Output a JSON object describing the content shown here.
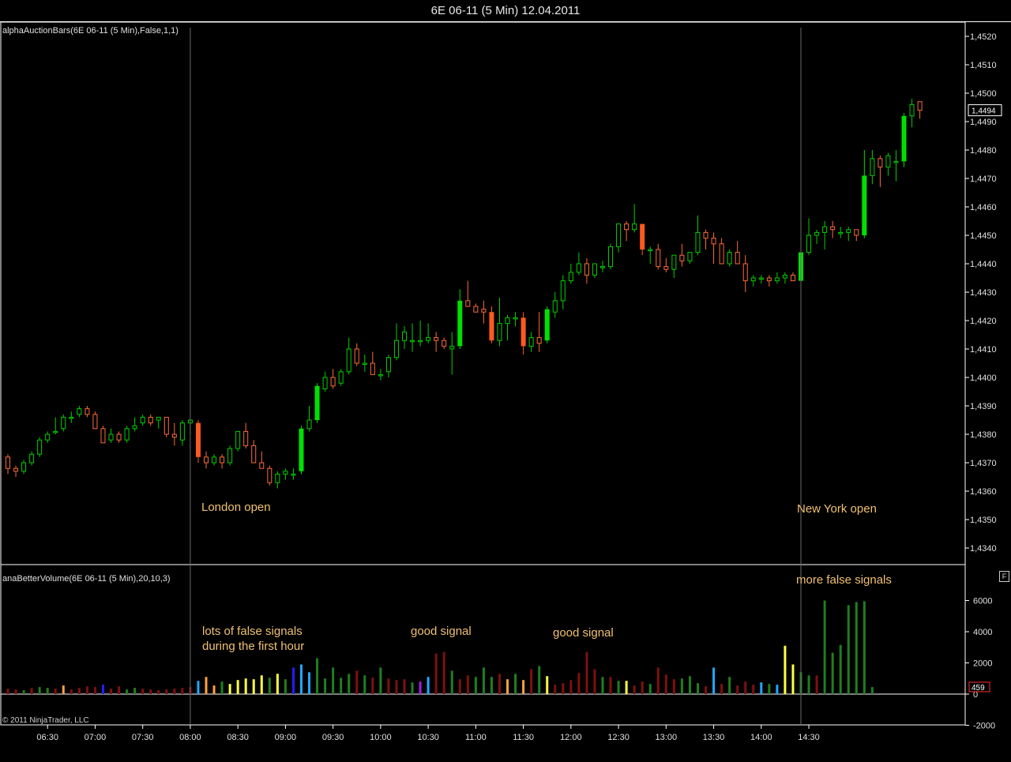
{
  "window": {
    "title": "6E 06-11 (5 Min)  12.04.2011"
  },
  "panels": {
    "price": {
      "indicator_label": "alphaAuctionBars(6E 06-11 (5 Min),False,1,1)"
    },
    "volume": {
      "indicator_label": "anaBetterVolume(6E 06-11 (5 Min),20,10,3)"
    }
  },
  "footer": {
    "copyright": "© 2011 NinjaTrader, LLC"
  },
  "annotations": {
    "london": "London open",
    "newyork": "New York open",
    "false_first": "lots of false signals",
    "false_second": "during the first hour",
    "good1": "good signal",
    "good2": "good signal",
    "more_false": "more false signals"
  },
  "colors": {
    "bull": "#00e000",
    "bear": "#ff5a1e",
    "hollow_bull": "#00d000",
    "hollow_bear": "#ff6a3a",
    "vol_green": "#1f7f1f",
    "vol_red": "#7f1010",
    "vol_yellow": "#ffff40",
    "vol_orange": "#ffa040",
    "vol_cyan": "#20a8ff",
    "vol_blue": "#2020ff",
    "vol_purple": "#a020e0"
  },
  "chart_data": [
    {
      "type": "candlestick",
      "title": "6E 06-11 (5 Min)  12.04.2011",
      "y_ticks": [
        "1,4520",
        "1,4510",
        "1,4500",
        "1,4490",
        "1,4480",
        "1,4470",
        "1,4460",
        "1,4450",
        "1,4440",
        "1,4430",
        "1,4420",
        "1,4410",
        "1,4400",
        "1,4390",
        "1,4380",
        "1,4370",
        "1,4360",
        "1,4350",
        "1,4340"
      ],
      "y_tick_values": [
        1.452,
        1.451,
        1.45,
        1.449,
        1.448,
        1.447,
        1.446,
        1.445,
        1.444,
        1.443,
        1.442,
        1.441,
        1.44,
        1.439,
        1.438,
        1.437,
        1.436,
        1.435,
        1.434
      ],
      "ylim": [
        1.4326,
        1.4528
      ],
      "last_price": "1,4494",
      "last_price_value": 1.4494,
      "x_ticks": [
        "06:30",
        "07:00",
        "07:30",
        "08:00",
        "08:30",
        "09:00",
        "09:30",
        "10:00",
        "10:30",
        "11:00",
        "11:30",
        "12:00",
        "12:30",
        "13:00",
        "13:30",
        "14:00",
        "14:30"
      ],
      "bar_start": "06:05",
      "bar_minutes": 5,
      "markers": [
        {
          "time": "08:00",
          "label": "London open"
        },
        {
          "time": "14:25",
          "label": "New York open"
        }
      ],
      "ohlc": [
        [
          1.4372,
          1.4373,
          1.4366,
          1.4368
        ],
        [
          1.4368,
          1.4369,
          1.4365,
          1.4367
        ],
        [
          1.4367,
          1.4371,
          1.4366,
          1.437
        ],
        [
          1.437,
          1.4374,
          1.4369,
          1.4373
        ],
        [
          1.4373,
          1.4379,
          1.4372,
          1.4378
        ],
        [
          1.4378,
          1.4381,
          1.4377,
          1.438
        ],
        [
          1.4381,
          1.4386,
          1.438,
          1.4381
        ],
        [
          1.4382,
          1.4387,
          1.4381,
          1.4386
        ],
        [
          1.4386,
          1.4388,
          1.4384,
          1.4386
        ],
        [
          1.4387,
          1.439,
          1.4386,
          1.4389
        ],
        [
          1.4389,
          1.439,
          1.4386,
          1.4387
        ],
        [
          1.4387,
          1.4388,
          1.4382,
          1.4382
        ],
        [
          1.4382,
          1.4383,
          1.4377,
          1.4377
        ],
        [
          1.4378,
          1.4382,
          1.4377,
          1.438
        ],
        [
          1.438,
          1.4381,
          1.4377,
          1.4378
        ],
        [
          1.4378,
          1.4383,
          1.4377,
          1.4382
        ],
        [
          1.4382,
          1.4386,
          1.4381,
          1.4383
        ],
        [
          1.4384,
          1.4387,
          1.4383,
          1.4386
        ],
        [
          1.4386,
          1.4387,
          1.4383,
          1.4384
        ],
        [
          1.4385,
          1.4386,
          1.4382,
          1.4386
        ],
        [
          1.4386,
          1.4386,
          1.4379,
          1.438
        ],
        [
          1.438,
          1.4384,
          1.4376,
          1.4379
        ],
        [
          1.4378,
          1.4385,
          1.4376,
          1.4384
        ],
        [
          1.4384,
          1.4385,
          1.438,
          1.4385
        ],
        [
          1.4384,
          1.4385,
          1.437,
          1.4372
        ],
        [
          1.4372,
          1.4374,
          1.4368,
          1.437
        ],
        [
          1.437,
          1.4373,
          1.4369,
          1.4372
        ],
        [
          1.4372,
          1.4373,
          1.4368,
          1.437
        ],
        [
          1.437,
          1.4376,
          1.4369,
          1.4375
        ],
        [
          1.4375,
          1.4381,
          1.4374,
          1.4381
        ],
        [
          1.4381,
          1.4384,
          1.4375,
          1.4376
        ],
        [
          1.4376,
          1.4378,
          1.437,
          1.437
        ],
        [
          1.437,
          1.4374,
          1.4368,
          1.4368
        ],
        [
          1.4368,
          1.4369,
          1.4362,
          1.4363
        ],
        [
          1.4363,
          1.4367,
          1.4361,
          1.4366
        ],
        [
          1.4366,
          1.4368,
          1.4364,
          1.4367
        ],
        [
          1.4366,
          1.4368,
          1.4364,
          1.4366
        ],
        [
          1.4367,
          1.4383,
          1.4366,
          1.4382
        ],
        [
          1.4382,
          1.439,
          1.4381,
          1.4385
        ],
        [
          1.4385,
          1.4398,
          1.4384,
          1.4397
        ],
        [
          1.4396,
          1.4402,
          1.4395,
          1.44
        ],
        [
          1.44,
          1.4403,
          1.4396,
          1.4397
        ],
        [
          1.4398,
          1.4403,
          1.4397,
          1.4402
        ],
        [
          1.4402,
          1.4414,
          1.4401,
          1.441
        ],
        [
          1.441,
          1.4412,
          1.4404,
          1.4405
        ],
        [
          1.4405,
          1.4408,
          1.4402,
          1.4405
        ],
        [
          1.4405,
          1.4409,
          1.4401,
          1.4401
        ],
        [
          1.4401,
          1.4403,
          1.4399,
          1.4401
        ],
        [
          1.4402,
          1.4408,
          1.44,
          1.4407
        ],
        [
          1.4407,
          1.4419,
          1.4406,
          1.4413
        ],
        [
          1.4413,
          1.4418,
          1.441,
          1.4416
        ],
        [
          1.4413,
          1.4419,
          1.4409,
          1.4413
        ],
        [
          1.4413,
          1.442,
          1.4411,
          1.4413
        ],
        [
          1.4413,
          1.4419,
          1.4412,
          1.4414
        ],
        [
          1.4414,
          1.4416,
          1.4409,
          1.4413
        ],
        [
          1.4413,
          1.4414,
          1.441,
          1.4411
        ],
        [
          1.441,
          1.4416,
          1.4401,
          1.4411
        ],
        [
          1.4411,
          1.4431,
          1.441,
          1.4427
        ],
        [
          1.4427,
          1.4434,
          1.4425,
          1.4425
        ],
        [
          1.4425,
          1.4426,
          1.4423,
          1.4423
        ],
        [
          1.4424,
          1.4427,
          1.4419,
          1.4423
        ],
        [
          1.4423,
          1.4425,
          1.4412,
          1.4413
        ],
        [
          1.4413,
          1.4428,
          1.4411,
          1.4419
        ],
        [
          1.4419,
          1.4422,
          1.4413,
          1.4421
        ],
        [
          1.4421,
          1.4423,
          1.4418,
          1.4421
        ],
        [
          1.4421,
          1.4423,
          1.4408,
          1.4411
        ],
        [
          1.4411,
          1.4416,
          1.4409,
          1.4414
        ],
        [
          1.4414,
          1.4423,
          1.4409,
          1.4412
        ],
        [
          1.4413,
          1.4425,
          1.4412,
          1.4424
        ],
        [
          1.4423,
          1.443,
          1.4421,
          1.4427
        ],
        [
          1.4427,
          1.4436,
          1.4424,
          1.4434
        ],
        [
          1.4434,
          1.444,
          1.4433,
          1.4437
        ],
        [
          1.4437,
          1.4444,
          1.4436,
          1.444
        ],
        [
          1.444,
          1.4442,
          1.4433,
          1.4436
        ],
        [
          1.4436,
          1.444,
          1.4435,
          1.444
        ],
        [
          1.4439,
          1.4441,
          1.4437,
          1.4439
        ],
        [
          1.4439,
          1.4447,
          1.4438,
          1.4446
        ],
        [
          1.4446,
          1.4453,
          1.4444,
          1.4454
        ],
        [
          1.4454,
          1.4455,
          1.4448,
          1.4452
        ],
        [
          1.4452,
          1.4461,
          1.4451,
          1.4454
        ],
        [
          1.4454,
          1.4454,
          1.4443,
          1.4445
        ],
        [
          1.4445,
          1.4446,
          1.444,
          1.4445
        ],
        [
          1.4445,
          1.4447,
          1.4438,
          1.4439
        ],
        [
          1.4439,
          1.4442,
          1.4437,
          1.4438
        ],
        [
          1.4438,
          1.4443,
          1.4435,
          1.4443
        ],
        [
          1.4443,
          1.4447,
          1.4439,
          1.4441
        ],
        [
          1.4441,
          1.4444,
          1.444,
          1.4444
        ],
        [
          1.4444,
          1.4457,
          1.4443,
          1.4451
        ],
        [
          1.4451,
          1.4452,
          1.4445,
          1.4449
        ],
        [
          1.4449,
          1.4451,
          1.444,
          1.4447
        ],
        [
          1.4447,
          1.4449,
          1.444,
          1.444
        ],
        [
          1.444,
          1.4445,
          1.4439,
          1.4444
        ],
        [
          1.4444,
          1.4448,
          1.444,
          1.444
        ],
        [
          1.444,
          1.4443,
          1.443,
          1.4434
        ],
        [
          1.4434,
          1.4436,
          1.4432,
          1.4435
        ],
        [
          1.4435,
          1.4436,
          1.4433,
          1.4435
        ],
        [
          1.4435,
          1.4436,
          1.4432,
          1.4434
        ],
        [
          1.4434,
          1.4437,
          1.4433,
          1.4435
        ],
        [
          1.4435,
          1.4437,
          1.4433,
          1.4436
        ],
        [
          1.4436,
          1.4437,
          1.4434,
          1.4434
        ],
        [
          1.4434,
          1.4447,
          1.4433,
          1.4444
        ],
        [
          1.4444,
          1.4456,
          1.4443,
          1.445
        ],
        [
          1.445,
          1.4452,
          1.4447,
          1.4451
        ],
        [
          1.4451,
          1.4455,
          1.4445,
          1.4453
        ],
        [
          1.4453,
          1.4455,
          1.4449,
          1.4452
        ],
        [
          1.4451,
          1.4453,
          1.4449,
          1.4451
        ],
        [
          1.4451,
          1.4453,
          1.4448,
          1.4452
        ],
        [
          1.4452,
          1.4452,
          1.4448,
          1.445
        ],
        [
          1.445,
          1.448,
          1.4449,
          1.4471
        ],
        [
          1.4471,
          1.448,
          1.4468,
          1.4477
        ],
        [
          1.4477,
          1.4478,
          1.4467,
          1.4474
        ],
        [
          1.4474,
          1.4479,
          1.4471,
          1.4478
        ],
        [
          1.4476,
          1.448,
          1.4469,
          1.4476
        ],
        [
          1.4476,
          1.4493,
          1.4474,
          1.4492
        ],
        [
          1.4492,
          1.4498,
          1.4488,
          1.4496
        ],
        [
          1.4497,
          1.4497,
          1.4491,
          1.4494
        ]
      ]
    },
    {
      "type": "bar",
      "title": "anaBetterVolume(6E 06-11 (5 Min),20,10,3)",
      "y_ticks": [
        "6000",
        "4000",
        "2000",
        "0",
        "-2000"
      ],
      "y_tick_values": [
        6000,
        4000,
        2000,
        0,
        -2000
      ],
      "ylim": [
        -2000,
        6500
      ],
      "last_value": "459",
      "last_value_number": 459,
      "color_codes": {
        "g": "green",
        "r": "red",
        "y": "yellow",
        "o": "orange",
        "c": "cyan",
        "b": "blue",
        "p": "purple"
      },
      "values": [
        350,
        300,
        250,
        400,
        450,
        400,
        350,
        550,
        300,
        400,
        500,
        450,
        600,
        350,
        500,
        300,
        400,
        350,
        300,
        250,
        300,
        350,
        400,
        450,
        850,
        1100,
        550,
        800,
        650,
        900,
        1000,
        950,
        1200,
        1050,
        1300,
        950,
        1700,
        1900,
        1400,
        2300,
        1000,
        1700,
        1050,
        1300,
        1500,
        1200,
        1050,
        1700,
        1000,
        900,
        950,
        750,
        800,
        1100,
        2600,
        2700,
        1500,
        950,
        1200,
        1100,
        1700,
        1100,
        1300,
        950,
        1300,
        900,
        1600,
        1800,
        1150,
        600,
        700,
        900,
        1350,
        2700,
        1600,
        1100,
        1100,
        850,
        850,
        550,
        800,
        650,
        1700,
        1250,
        950,
        1000,
        1150,
        700,
        500,
        1700,
        650,
        1100,
        550,
        800,
        600,
        750,
        650,
        600,
        3100,
        1900,
        1400,
        1200,
        1200,
        6000,
        2650,
        3150,
        5700,
        5900,
        5950,
        450
      ],
      "colors": "rrgrggrorrrrbrrggrrrrrrrcoogyyyyygygbccgggggrgrgrrrgpcrrgrrgggrogorgyrrrrrrgrgyrrgrrrgggrcrgrrrcgcyyggr"
    }
  ]
}
